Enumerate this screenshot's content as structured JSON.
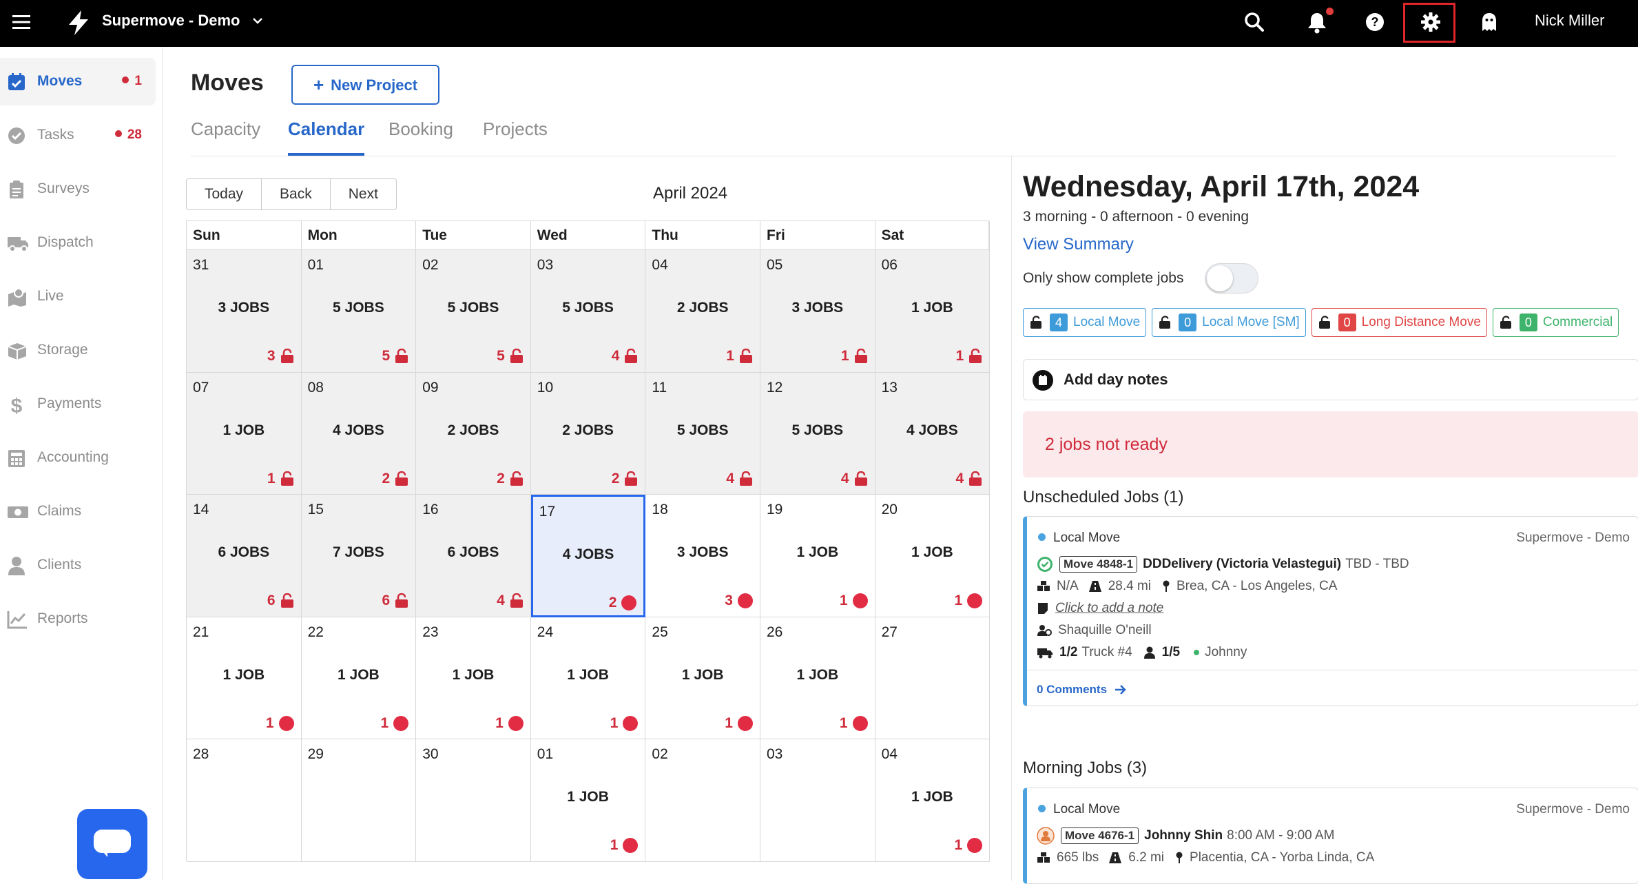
{
  "topbar": {
    "org_name": "Supermove - Demo",
    "user_name": "Nick Miller"
  },
  "sidebar": {
    "items": [
      {
        "label": "Moves",
        "badge": "1",
        "icon": "calendar-check-icon"
      },
      {
        "label": "Tasks",
        "badge": "28",
        "icon": "check-circle-icon"
      },
      {
        "label": "Surveys",
        "icon": "clipboard-icon"
      },
      {
        "label": "Dispatch",
        "icon": "truck-icon"
      },
      {
        "label": "Live",
        "icon": "map-pin-icon"
      },
      {
        "label": "Storage",
        "icon": "box-icon"
      },
      {
        "label": "Payments",
        "icon": "dollar-icon"
      },
      {
        "label": "Accounting",
        "icon": "calculator-icon"
      },
      {
        "label": "Claims",
        "icon": "money-icon"
      },
      {
        "label": "Clients",
        "icon": "user-icon"
      },
      {
        "label": "Reports",
        "icon": "chart-icon"
      }
    ]
  },
  "page": {
    "title": "Moves",
    "new_project": "New Project",
    "tabs": [
      "Capacity",
      "Calendar",
      "Booking",
      "Projects"
    ]
  },
  "calendar": {
    "nav": [
      "Today",
      "Back",
      "Next"
    ],
    "month": "April 2024",
    "weekdays": [
      "Sun",
      "Mon",
      "Tue",
      "Wed",
      "Thu",
      "Fri",
      "Sat"
    ],
    "weeks": [
      [
        {
          "day": "31",
          "jobs": "3 JOBS",
          "count": "3",
          "status": "lock"
        },
        {
          "day": "01",
          "jobs": "5 JOBS",
          "count": "5",
          "status": "lock"
        },
        {
          "day": "02",
          "jobs": "5 JOBS",
          "count": "5",
          "status": "lock"
        },
        {
          "day": "03",
          "jobs": "5 JOBS",
          "count": "4",
          "status": "lock"
        },
        {
          "day": "04",
          "jobs": "2 JOBS",
          "count": "1",
          "status": "lock"
        },
        {
          "day": "05",
          "jobs": "3 JOBS",
          "count": "1",
          "status": "lock"
        },
        {
          "day": "06",
          "jobs": "1 JOB",
          "count": "1",
          "status": "lock"
        }
      ],
      [
        {
          "day": "07",
          "jobs": "1 JOB",
          "count": "1",
          "status": "lock"
        },
        {
          "day": "08",
          "jobs": "4 JOBS",
          "count": "2",
          "status": "lock"
        },
        {
          "day": "09",
          "jobs": "2 JOBS",
          "count": "2",
          "status": "lock"
        },
        {
          "day": "10",
          "jobs": "2 JOBS",
          "count": "2",
          "status": "lock"
        },
        {
          "day": "11",
          "jobs": "5 JOBS",
          "count": "4",
          "status": "lock"
        },
        {
          "day": "12",
          "jobs": "5 JOBS",
          "count": "4",
          "status": "lock"
        },
        {
          "day": "13",
          "jobs": "4 JOBS",
          "count": "4",
          "status": "lock"
        }
      ],
      [
        {
          "day": "14",
          "jobs": "6 JOBS",
          "count": "6",
          "status": "lock"
        },
        {
          "day": "15",
          "jobs": "7 JOBS",
          "count": "6",
          "status": "lock"
        },
        {
          "day": "16",
          "jobs": "6 JOBS",
          "count": "4",
          "status": "lock"
        },
        {
          "day": "17",
          "jobs": "4 JOBS",
          "count": "2",
          "status": "dot",
          "selected": true
        },
        {
          "day": "18",
          "jobs": "3 JOBS",
          "count": "3",
          "status": "dot"
        },
        {
          "day": "19",
          "jobs": "1 JOB",
          "count": "1",
          "status": "dot"
        },
        {
          "day": "20",
          "jobs": "1 JOB",
          "count": "1",
          "status": "dot"
        }
      ],
      [
        {
          "day": "21",
          "jobs": "1 JOB",
          "count": "1",
          "status": "dot"
        },
        {
          "day": "22",
          "jobs": "1 JOB",
          "count": "1",
          "status": "dot"
        },
        {
          "day": "23",
          "jobs": "1 JOB",
          "count": "1",
          "status": "dot"
        },
        {
          "day": "24",
          "jobs": "1 JOB",
          "count": "1",
          "status": "dot"
        },
        {
          "day": "25",
          "jobs": "1 JOB",
          "count": "1",
          "status": "dot"
        },
        {
          "day": "26",
          "jobs": "1 JOB",
          "count": "1",
          "status": "dot"
        },
        {
          "day": "27",
          "jobs": "",
          "count": "",
          "status": ""
        }
      ],
      [
        {
          "day": "28",
          "jobs": "",
          "count": "",
          "status": ""
        },
        {
          "day": "29",
          "jobs": "",
          "count": "",
          "status": ""
        },
        {
          "day": "30",
          "jobs": "",
          "count": "",
          "status": ""
        },
        {
          "day": "01",
          "jobs": "1 JOB",
          "count": "1",
          "status": "dot"
        },
        {
          "day": "02",
          "jobs": "",
          "count": "",
          "status": ""
        },
        {
          "day": "03",
          "jobs": "",
          "count": "",
          "status": ""
        },
        {
          "day": "04",
          "jobs": "1 JOB",
          "count": "1",
          "status": "dot"
        }
      ]
    ]
  },
  "day_panel": {
    "title": "Wednesday, April 17th, 2024",
    "subtitle": "3 morning - 0 afternoon - 0 evening",
    "view_summary": "View Summary",
    "only_complete": "Only show complete jobs",
    "chips": [
      {
        "count": "4",
        "label": "Local Move",
        "color": "#3e9bd9"
      },
      {
        "count": "0",
        "label": "Local Move [SM]",
        "color": "#3e9bd9"
      },
      {
        "count": "0",
        "label": "Long Distance Move",
        "color": "#e04646"
      },
      {
        "count": "0",
        "label": "Commercial",
        "color": "#3db36b"
      }
    ],
    "add_day_notes": "Add day notes",
    "not_ready": "2 jobs not ready",
    "unscheduled_head": "Unscheduled Jobs (1)",
    "morning_head": "Morning Jobs (3)",
    "unscheduled_job": {
      "type": "Local Move",
      "org": "Supermove - Demo",
      "move_id": "Move 4848-1",
      "client": "DDDelivery (Victoria Velastegui)",
      "time": "TBD - TBD",
      "weight": "N/A",
      "distance": "28.4 mi",
      "route": "Brea, CA - Los Angeles, CA",
      "note": "Click to add a note",
      "coordinator": "Shaquille O'neill",
      "trucks": "1/2",
      "truck_name": "Truck #4",
      "crew": "1/5",
      "crew_name": "Johnny",
      "comments": "0 Comments"
    },
    "morning_job": {
      "type": "Local Move",
      "org": "Supermove - Demo",
      "move_id": "Move 4676-1",
      "client": "Johnny Shin",
      "time": "8:00 AM - 9:00 AM",
      "weight": "665 lbs",
      "distance": "6.2 mi",
      "route": "Placentia, CA - Yorba Linda, CA"
    }
  }
}
